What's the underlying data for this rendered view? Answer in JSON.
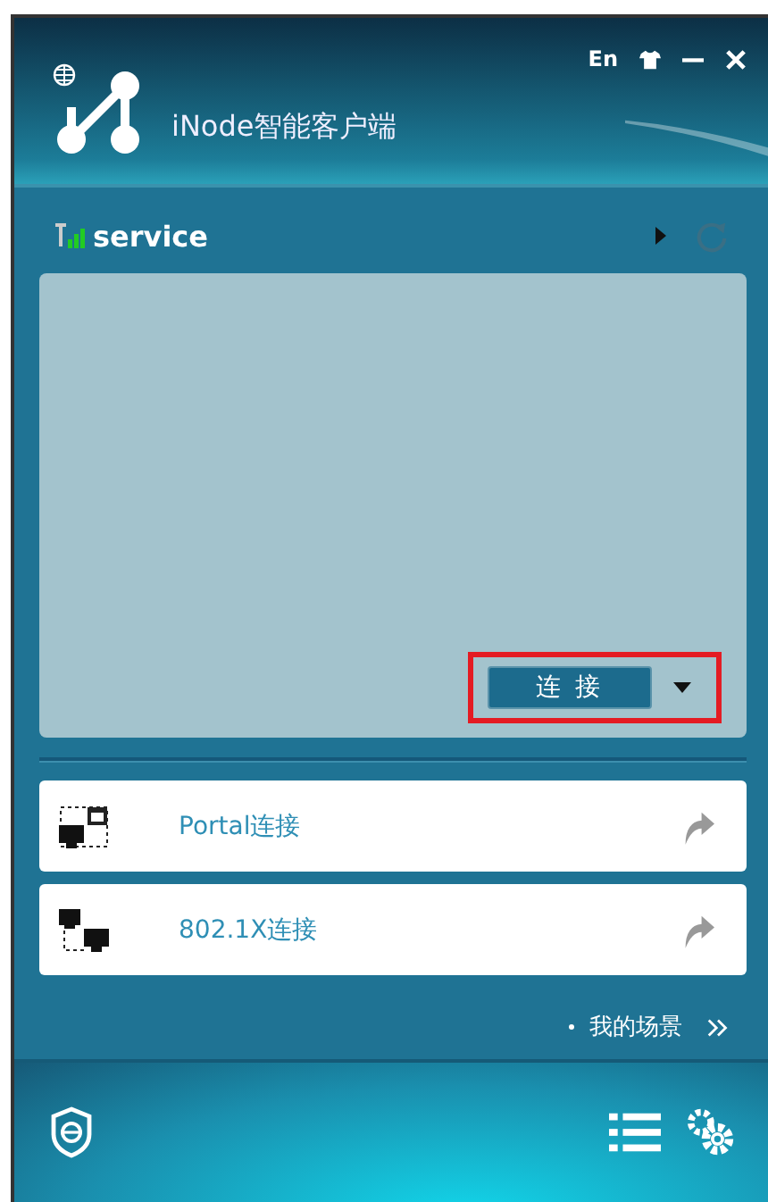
{
  "window": {
    "title": "iNode智能客户端",
    "language": "En"
  },
  "network": {
    "name": "service",
    "connect_button": "连 接"
  },
  "connections": [
    {
      "kind": "portal",
      "label": "Portal连接"
    },
    {
      "kind": "dot1x",
      "label": "802.1X连接"
    }
  ],
  "scenes_link": "我的场景"
}
